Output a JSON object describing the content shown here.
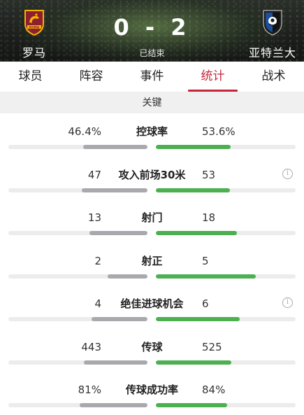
{
  "match": {
    "home_team": "罗马",
    "away_team": "亚特兰大",
    "home_score": "0",
    "away_score": "2",
    "score_separator": "-",
    "status": "已结束"
  },
  "tabs": [
    {
      "label": "球员",
      "active": false
    },
    {
      "label": "阵容",
      "active": false
    },
    {
      "label": "事件",
      "active": false
    },
    {
      "label": "统计",
      "active": true
    },
    {
      "label": "战术",
      "active": false
    }
  ],
  "section_title": "关键",
  "colors": {
    "accent": "#c4263a",
    "home_bar": "#a9a9ad",
    "away_bar": "#4caf50"
  },
  "stats": [
    {
      "label": "控球率",
      "home": "46.4%",
      "away": "53.6%",
      "home_share": 0.464,
      "away_share": 0.536,
      "info": false
    },
    {
      "label": "攻入前场30米",
      "home": "47",
      "away": "53",
      "home_share": 0.47,
      "away_share": 0.53,
      "info": true
    },
    {
      "label": "射门",
      "home": "13",
      "away": "18",
      "home_share": 0.419,
      "away_share": 0.581,
      "info": false
    },
    {
      "label": "射正",
      "home": "2",
      "away": "5",
      "home_share": 0.286,
      "away_share": 0.714,
      "info": false
    },
    {
      "label": "绝佳进球机会",
      "home": "4",
      "away": "6",
      "home_share": 0.4,
      "away_share": 0.6,
      "info": true
    },
    {
      "label": "传球",
      "home": "443",
      "away": "525",
      "home_share": 0.458,
      "away_share": 0.542,
      "info": false
    },
    {
      "label": "传球成功率",
      "home": "81%",
      "away": "84%",
      "home_share": 0.49,
      "away_share": 0.51,
      "info": false
    }
  ]
}
